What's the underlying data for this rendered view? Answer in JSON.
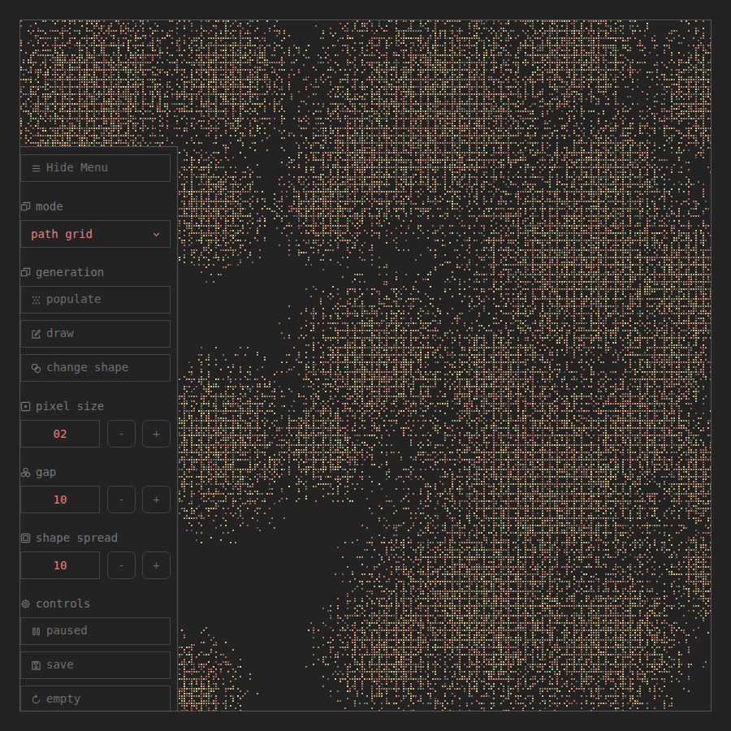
{
  "menu_toggle": {
    "label": "Hide Menu"
  },
  "mode": {
    "label": "mode",
    "value": "path grid"
  },
  "generation": {
    "label": "generation",
    "buttons": [
      {
        "label": "populate"
      },
      {
        "label": "draw"
      },
      {
        "label": "change shape"
      }
    ]
  },
  "steppers": [
    {
      "label": "pixel size",
      "value": "02",
      "minus": "-",
      "plus": "+"
    },
    {
      "label": "gap",
      "value": "10",
      "minus": "-",
      "plus": "+"
    },
    {
      "label": "shape spread",
      "value": "10",
      "minus": "-",
      "plus": "+"
    }
  ],
  "controls": {
    "label": "controls",
    "buttons": [
      {
        "label": "paused"
      },
      {
        "label": "save"
      },
      {
        "label": "empty"
      }
    ]
  }
}
